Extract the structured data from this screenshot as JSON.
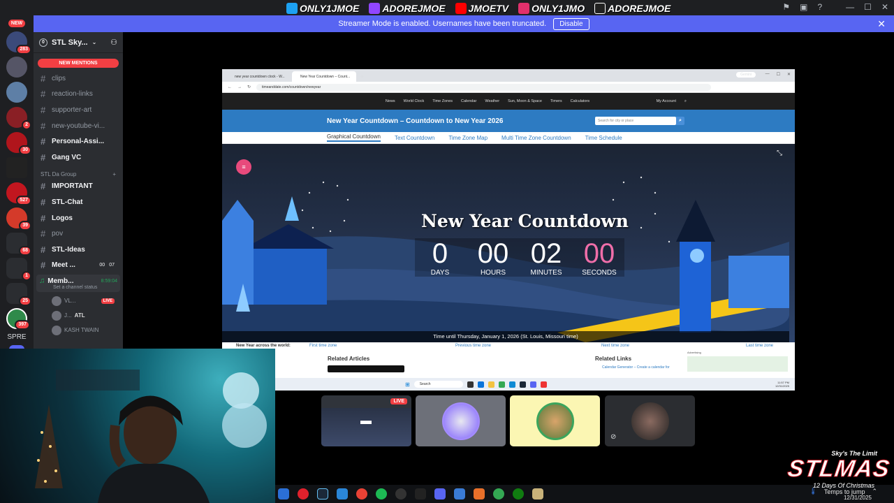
{
  "topbar": {
    "socials": [
      {
        "name": "twitter-icon",
        "handle": "ONLY1JMOE",
        "color": "#1da1f2"
      },
      {
        "name": "twitch-icon",
        "handle": "ADOREJMOE",
        "color": "#9146ff"
      },
      {
        "name": "youtube-icon",
        "handle": "JMOETV",
        "color": "#ff0000"
      },
      {
        "name": "instagram-icon",
        "handle": "ONLY1JMO",
        "color": "#e1306c"
      },
      {
        "name": "tiktok-icon",
        "handle": "ADOREJMOE",
        "color": "#ffffff"
      }
    ]
  },
  "streamer_banner": {
    "message": "Streamer Mode is enabled. Usernames have been truncated.",
    "button": "Disable",
    "color": "#5865f2"
  },
  "rail": {
    "new_tag": "NEW",
    "badges": [
      "283",
      "2",
      "30",
      "527",
      "39",
      "68",
      "1",
      "25",
      "397"
    ],
    "label": "SPRE"
  },
  "server": {
    "name": "STL Sky...",
    "new_mentions": "NEW MENTIONS",
    "channels_top": [
      "clips",
      "reaction-links",
      "supporter-art",
      "new-youtube-vi...",
      "Personal-Assi...",
      "Gang VC"
    ],
    "category": "STL Da Group",
    "channels_group": [
      "IMPORTANT",
      "STL-Chat",
      "Logos",
      "pov",
      "STL-Ideas"
    ],
    "meet": {
      "label": "Meet ...",
      "count_a": "00",
      "count_b": "07"
    },
    "voice": {
      "name": "Memb...",
      "time": "8:59:04",
      "status": "Set a channel status"
    },
    "voice_members": [
      {
        "name": "VL...",
        "live": "LIVE"
      },
      {
        "name": "J...",
        "tag": "ATL"
      },
      {
        "name": "KASH TWAIN"
      }
    ]
  },
  "browser": {
    "tabs": [
      "new year countdown clock - W...",
      "New Year Countdown – Count..."
    ],
    "gemini": "Gemini",
    "url": "timeanddate.com/countdown/newyear",
    "nav": [
      "News",
      "World Clock",
      "Time Zones",
      "Calendar",
      "Weather",
      "Sun, Moon & Space",
      "Timers",
      "Calculators"
    ],
    "account": "My Account",
    "title": "New Year Countdown – Countdown to New Year 2026",
    "search_placeholder": "Search for city or place",
    "subtabs": [
      "Graphical Countdown",
      "Text Countdown",
      "Time Zone Map",
      "Multi Time Zone Countdown",
      "Time Schedule"
    ],
    "countdown_title": "New Year Countdown",
    "countdown": [
      {
        "value": "0",
        "label": "DAYS"
      },
      {
        "value": "00",
        "label": "HOURS"
      },
      {
        "value": "02",
        "label": "MINUTES"
      },
      {
        "value": "00",
        "label": "SECONDS"
      }
    ],
    "time_until": "Time until Thursday, January 1, 2026 (St. Louis, Missouri time)",
    "tz_nav": [
      "New Year across the world:",
      "First time zone",
      "Previous time zone",
      "Next time zone",
      "Last time zone"
    ],
    "related_articles": "Related Articles",
    "related_links": "Related Links",
    "related_link_1": "Calendar Generator – Create a calendar for",
    "advertising": "Advertising",
    "win_search": "Search",
    "win_time": "11:57 PM",
    "win_date": "12/31/2025"
  },
  "voice_tiles": {
    "live": "LIVE"
  },
  "taskbar": {
    "tray_text": "Temps to jump",
    "date": "12/31/2025"
  },
  "brand": {
    "line1": "Sky's The Limit",
    "line2": "STLMAS",
    "line3": "12 Days Of Christmas"
  }
}
